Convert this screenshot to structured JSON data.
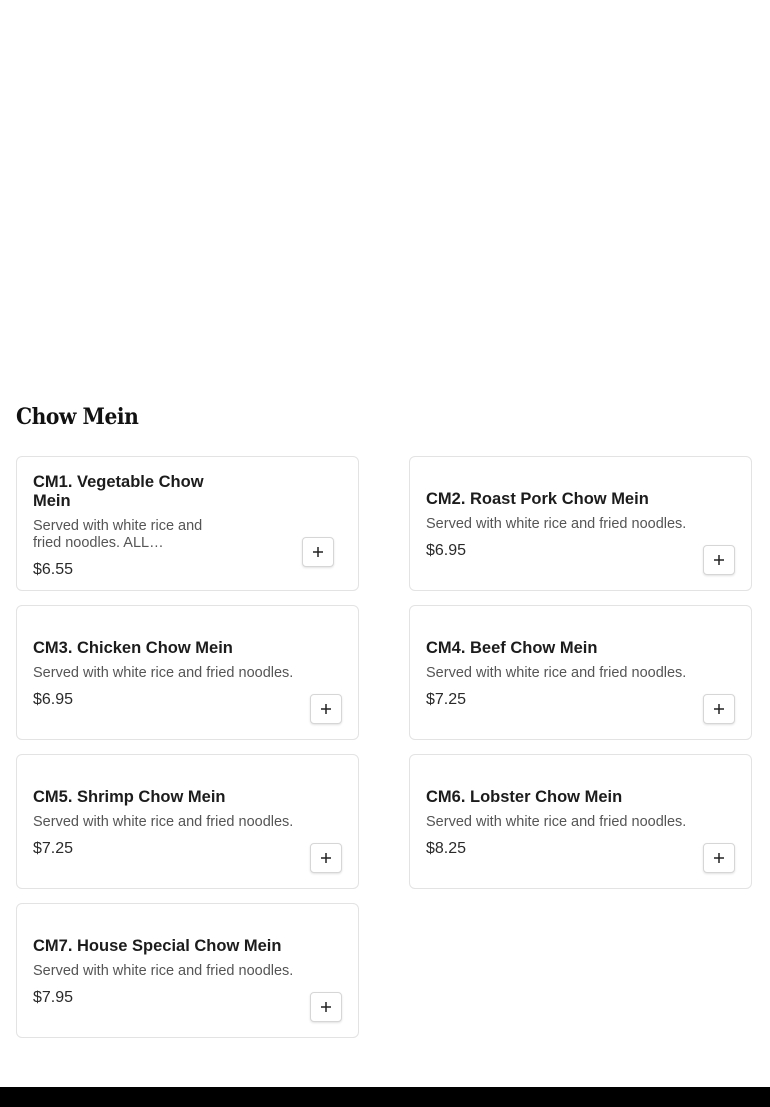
{
  "section": {
    "title": "Chow Mein"
  },
  "items": [
    {
      "name": "CM1. Vegetable Chow Mein",
      "description": "Served with white rice and fried noodles. ALL…",
      "price": "$6.55",
      "add_icon": "plus-icon"
    },
    {
      "name": "CM2. Roast Pork Chow Mein",
      "description": "Served with white rice and fried noodles.",
      "price": "$6.95",
      "add_icon": "plus-icon"
    },
    {
      "name": "CM3. Chicken Chow Mein",
      "description": "Served with white rice and fried noodles.",
      "price": "$6.95",
      "add_icon": "plus-icon"
    },
    {
      "name": "CM4. Beef Chow Mein",
      "description": "Served with white rice and fried noodles.",
      "price": "$7.25",
      "add_icon": "plus-icon"
    },
    {
      "name": "CM5. Shrimp Chow Mein",
      "description": "Served with white rice and fried noodles.",
      "price": "$7.25",
      "add_icon": "plus-icon"
    },
    {
      "name": "CM6. Lobster Chow Mein",
      "description": "Served with white rice and fried noodles.",
      "price": "$8.25",
      "add_icon": "plus-icon"
    },
    {
      "name": "CM7. House Special Chow Mein",
      "description": "Served with white rice and fried noodles.",
      "price": "$7.95",
      "add_icon": "plus-icon"
    }
  ]
}
